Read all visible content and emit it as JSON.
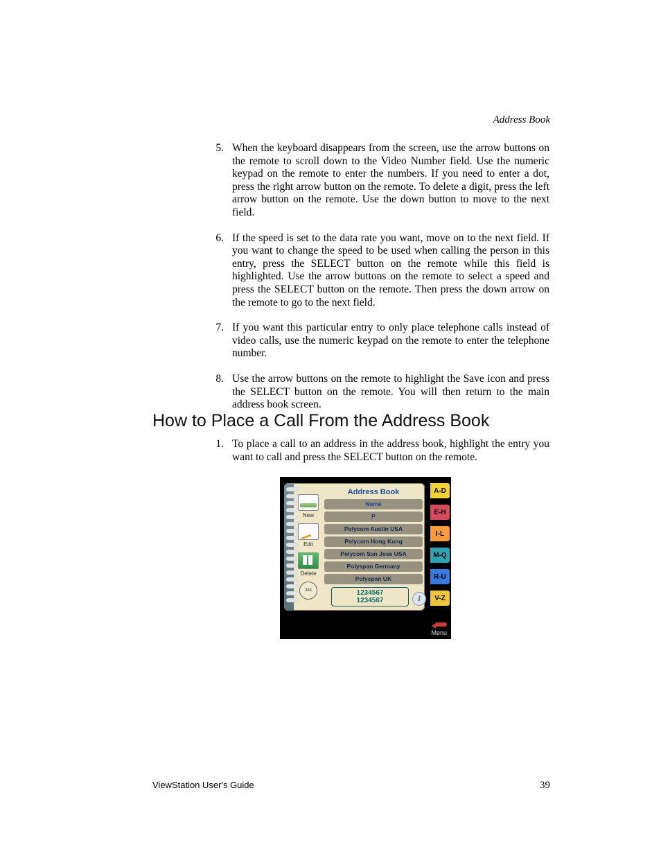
{
  "running_head": "Address Book",
  "steps_cont": [
    {
      "n": "5.",
      "text": "When the keyboard disappears from the screen, use the arrow buttons on the remote to scroll down to the Video Number field. Use the numeric keypad on the remote to enter the numbers. If you need to enter a dot, press the right arrow button on the remote. To delete a digit, press the left arrow button on the remote. Use the down button to move to the next field."
    },
    {
      "n": "6.",
      "text": "If the speed is set to the data rate you want, move on to the next field. If you want to change the speed to be used when calling the person in this entry, press the SELECT button on the remote while this field is highlighted. Use the arrow buttons on the remote to select a speed and press the SELECT button on the remote. Then press the down arrow on the remote to go to the next field."
    },
    {
      "n": "7.",
      "text": "If you want this particular entry to only place telephone calls instead of video calls, use the numeric keypad on the remote to enter the telephone number."
    },
    {
      "n": "8.",
      "text": "Use the arrow buttons on the remote to highlight the Save icon and press the SELECT button on the remote. You will then return to the main address book screen."
    }
  ],
  "section_heading": "How to Place a Call From the Address Book",
  "steps_new": [
    {
      "n": "1.",
      "text": "To place a call to an address in the address book, highlight the entry you want to call and press the SELECT button on the remote."
    }
  ],
  "footer_left": "ViewStation User's Guide",
  "footer_right": "39",
  "ab": {
    "title": "Address Book",
    "header": "Name",
    "search": "P",
    "entries": [
      "Polycom Austin USA",
      "Polycom Hong Kong",
      "Polycom San Jose USA",
      "Polyspan Germany",
      "Polyspan UK"
    ],
    "num1": "1234567",
    "num2": "1234567",
    "left": {
      "new": "New",
      "edit": "Edit",
      "delete": "Delete",
      "speed": "384"
    },
    "tabs": [
      "A-D",
      "E-H",
      "I-L",
      "M-Q",
      "R-U",
      "V-Z"
    ],
    "menu": "Menu"
  }
}
